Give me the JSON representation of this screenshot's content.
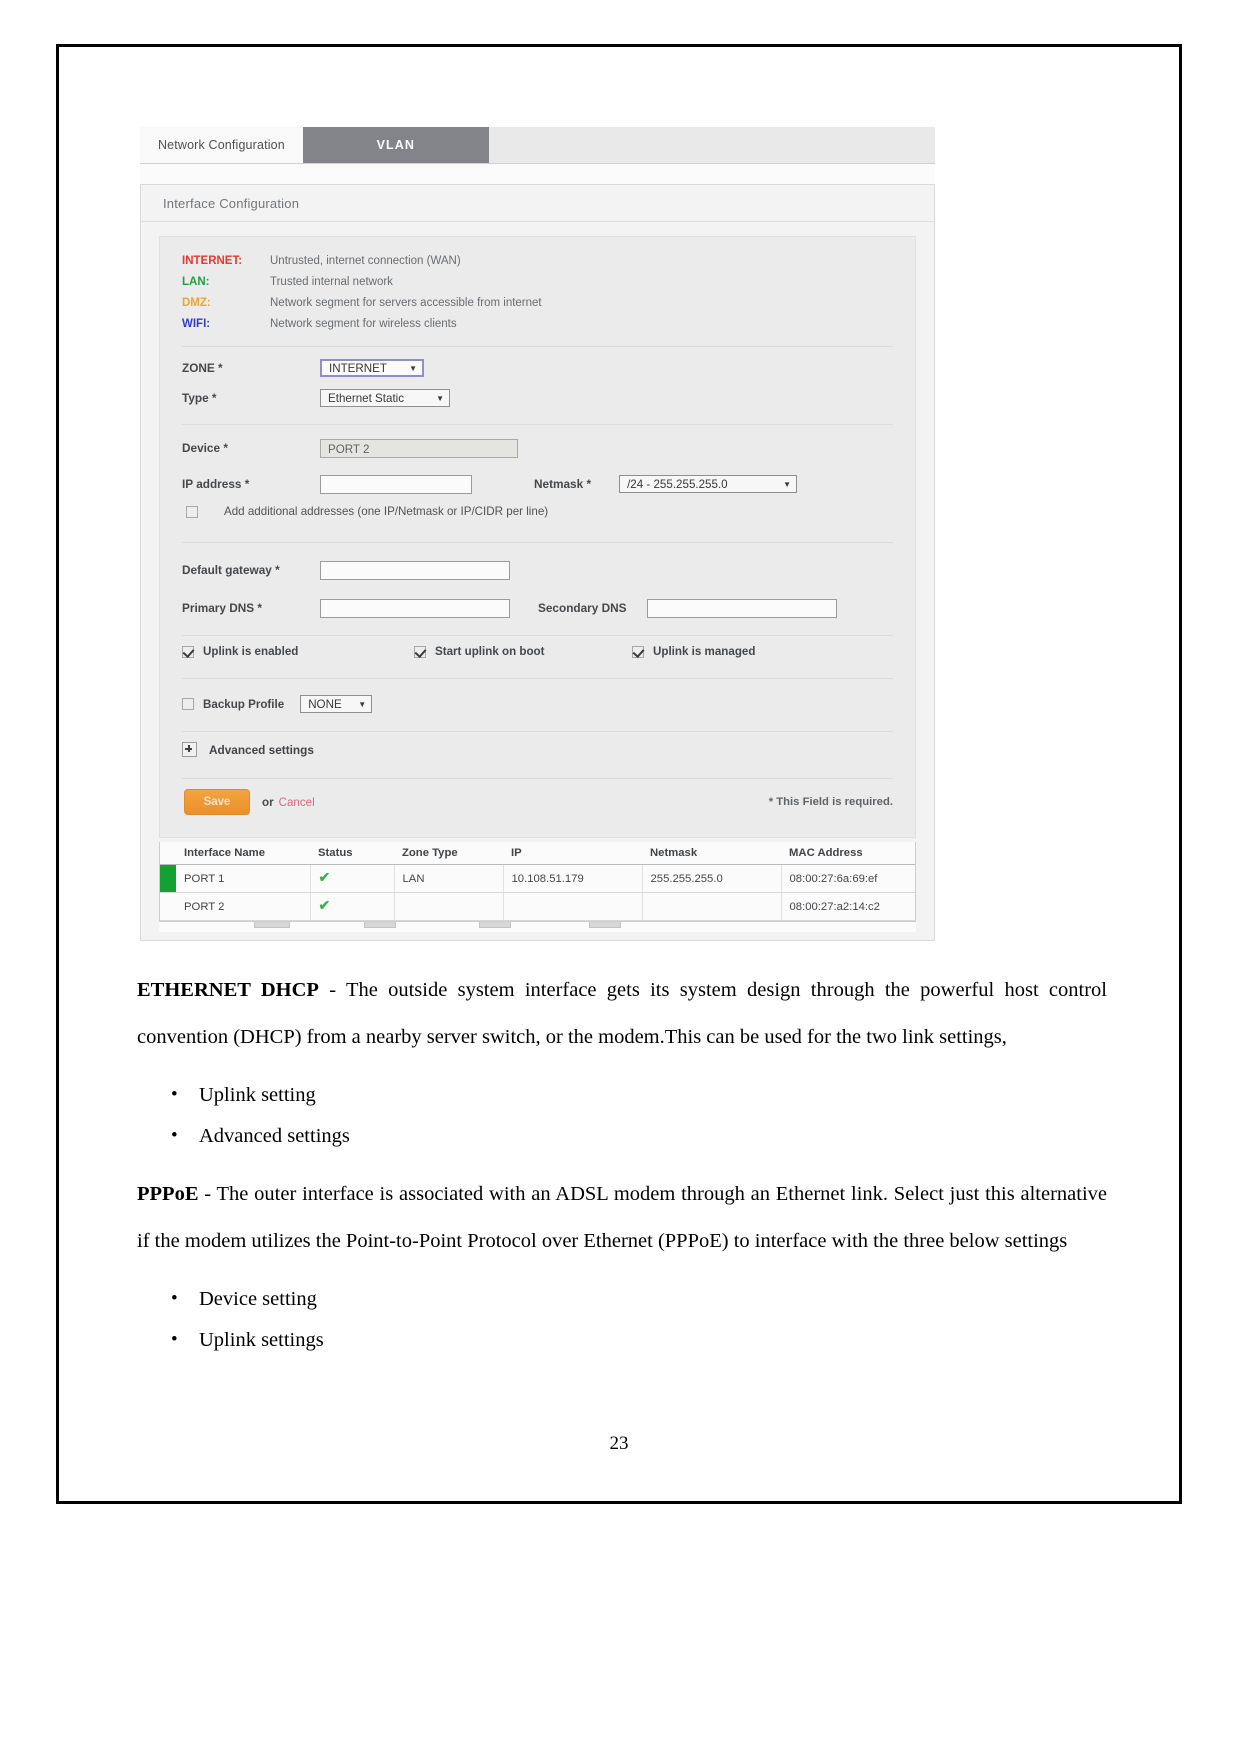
{
  "screenshot": {
    "tabs": [
      {
        "label": "Network Configuration",
        "state": "inactive"
      },
      {
        "label": "VLAN",
        "state": "active"
      }
    ],
    "panel_title": "Interface Configuration",
    "zone_legend": [
      {
        "key": "INTERNET:",
        "desc": "Untrusted, internet connection (WAN)",
        "color": "#e8322b"
      },
      {
        "key": "LAN:",
        "desc": "Trusted  internal network",
        "color": "#1f9a3f"
      },
      {
        "key": "DMZ:",
        "desc": "Network segment for servers accessible from internet",
        "color": "#f0a32a"
      },
      {
        "key": "WIFI:",
        "desc": "Network segment for wireless clients",
        "color": "#2a36c9"
      }
    ],
    "form": {
      "zone_label": "ZONE *",
      "zone_value": "INTERNET",
      "type_label": "Type *",
      "type_value": "Ethernet Static",
      "device_label": "Device *",
      "device_value": "PORT 2",
      "ip_label": "IP address *",
      "ip_value": "",
      "netmask_label": "Netmask *",
      "netmask_value": "/24 - 255.255.255.0",
      "additional_addresses_label": "Add additional addresses (one IP/Netmask or IP/CIDR per line)",
      "additional_addresses_checked": false,
      "gateway_label": "Default gateway *",
      "gateway_value": "",
      "primary_dns_label": "Primary DNS *",
      "primary_dns_value": "",
      "secondary_dns_label": "Secondary DNS",
      "secondary_dns_value": "",
      "uplink_options": [
        {
          "label": "Uplink is enabled",
          "checked": true
        },
        {
          "label": "Start uplink on boot",
          "checked": true
        },
        {
          "label": "Uplink is managed",
          "checked": true
        }
      ],
      "backup_profile_label": "Backup Profile",
      "backup_profile_checked": false,
      "backup_profile_value": "NONE",
      "advanced_settings_label": "Advanced settings",
      "save_label": "Save",
      "or_label": "or",
      "cancel_label": "Cancel",
      "required_note": "* This Field is required."
    },
    "interface_table": {
      "columns": [
        "Interface Name",
        "Status",
        "Zone Type",
        "IP",
        "Netmask",
        "MAC Address"
      ],
      "rows": [
        {
          "swatch": "#0aa02a",
          "name": "PORT 1",
          "status": "✔",
          "zone_type": "LAN",
          "ip": "10.108.51.179",
          "netmask": "255.255.255.0",
          "mac": "08:00:27:6a:69:ef"
        },
        {
          "swatch": "",
          "name": "PORT 2",
          "status": "✔",
          "zone_type": "",
          "ip": "",
          "netmask": "",
          "mac": "08:00:27:a2:14:c2"
        }
      ]
    }
  },
  "document": {
    "ethernet_dhcp_heading": "ETHERNET DHCP",
    "ethernet_dhcp_body": " - The outside system interface gets its system design through the powerful host control convention (DHCP) from a nearby server switch, or the modem.This can be used for the two link settings,",
    "dhcp_bullets": [
      "Uplink setting",
      "Advanced settings"
    ],
    "pppoe_heading": "PPPoE",
    "pppoe_body": " - The outer interface is associated with an ADSL modem through an Ethernet link. Select just this alternative if the modem utilizes the Point-to-Point Protocol over Ethernet (PPPoE) to interface with the three below settings",
    "pppoe_bullets": [
      "Device setting",
      "Uplink settings"
    ],
    "page_number": "23"
  }
}
